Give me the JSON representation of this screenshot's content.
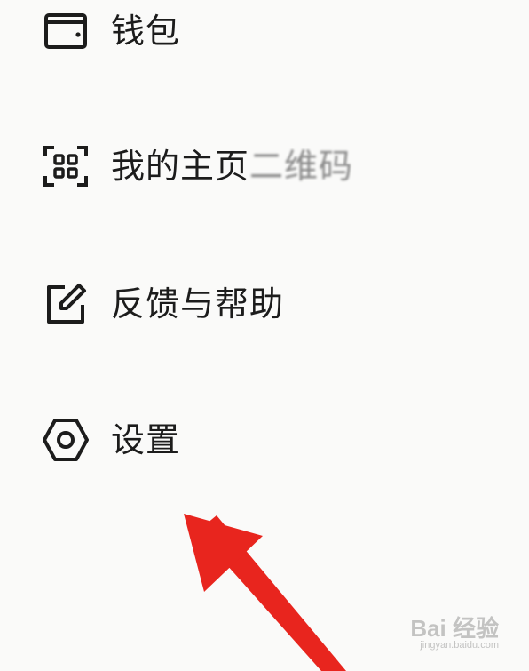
{
  "menu": {
    "items": [
      {
        "label": "钱包",
        "icon": "wallet-icon"
      },
      {
        "label": "我的主页",
        "label_tail": "二维码",
        "icon": "qrcode-icon"
      },
      {
        "label": "反馈与帮助",
        "icon": "edit-icon"
      },
      {
        "label": "设置",
        "icon": "gear-icon"
      }
    ]
  },
  "annotation": {
    "arrow_color": "#e8251e",
    "points_to": "设置"
  },
  "watermark": {
    "brand": "Bai 经验",
    "site": "jingyan.baidu.com"
  }
}
